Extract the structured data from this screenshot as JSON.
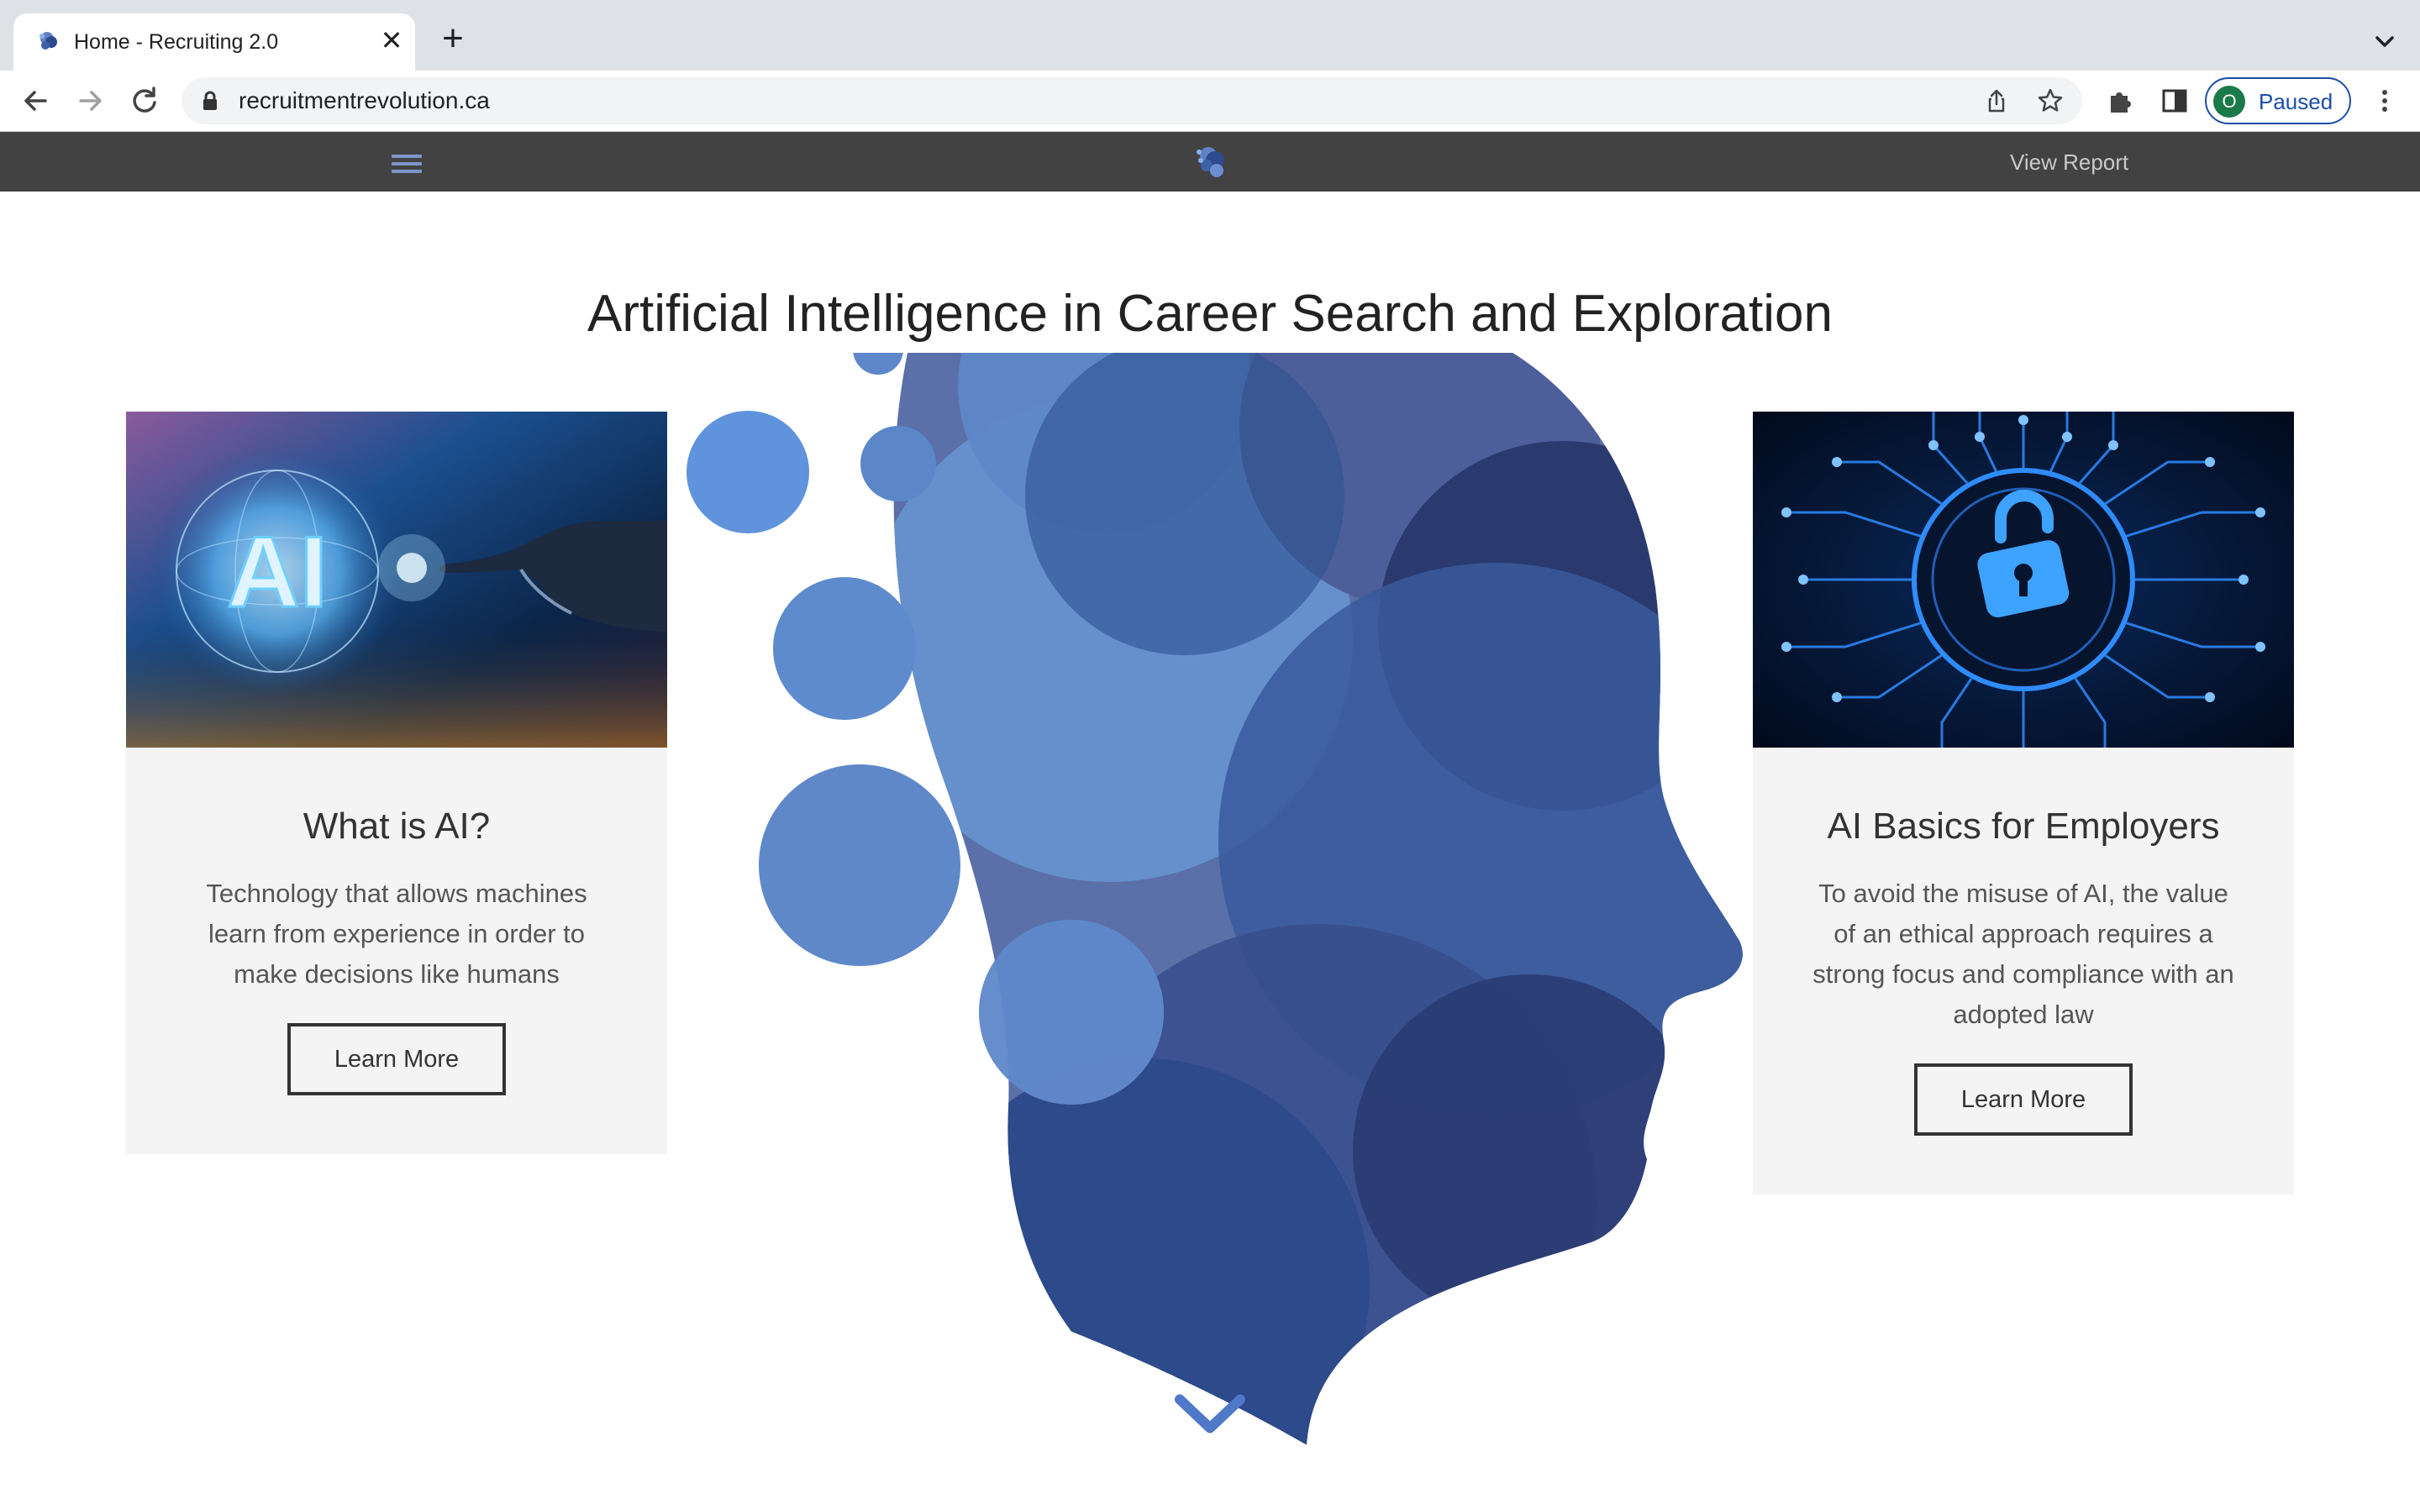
{
  "browser": {
    "tab": {
      "title": "Home - Recruiting 2.0",
      "close_symbol": "✕"
    },
    "new_tab_symbol": "+",
    "url": "recruitmentrevolution.ca",
    "profile": {
      "initial": "O",
      "status": "Paused"
    }
  },
  "site_nav": {
    "view_report_label": "View Report"
  },
  "page": {
    "title": "Artificial Intelligence in Career Search and Exploration"
  },
  "cards": [
    {
      "title": "What is AI?",
      "text": "Technology that allows machines learn from experience in order to make decisions like humans",
      "button_label": "Learn More",
      "image_text": "AI"
    },
    {
      "title": "AI Basics for Employers",
      "text": "To avoid the misuse of AI, the value of an ethical approach requires a strong focus and compliance with an adopted law",
      "button_label": "Learn More"
    }
  ],
  "icons": {
    "favicon": "brain-head-icon",
    "back": "arrow-left-icon",
    "forward": "arrow-right-icon",
    "reload": "reload-icon",
    "lock": "lock-icon",
    "share": "share-icon",
    "bookmark": "star-icon",
    "extensions": "puzzle-icon",
    "side_panel": "side-panel-icon",
    "menu": "kebab-menu-icon",
    "hamburger": "hamburger-icon",
    "scroll": "chevron-down-icon"
  },
  "colors": {
    "nav_bg": "#424242",
    "card_bg": "#f4f4f4",
    "head_blue": "#5c7fc0",
    "profile_blue": "#1a4ea8"
  }
}
